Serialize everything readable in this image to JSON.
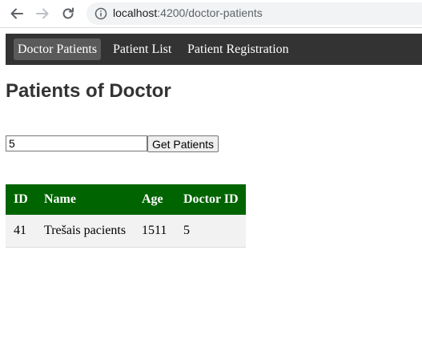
{
  "browser": {
    "url_host": "localhost",
    "url_path": ":4200/doctor-patients"
  },
  "nav": {
    "items": [
      {
        "label": "Doctor Patients",
        "active": true
      },
      {
        "label": "Patient List",
        "active": false
      },
      {
        "label": "Patient Registration",
        "active": false
      }
    ]
  },
  "page": {
    "title": "Patients of Doctor",
    "doctor_id_value": "5",
    "get_button_label": "Get Patients"
  },
  "table": {
    "headers": [
      "ID",
      "Name",
      "Age",
      "Doctor ID"
    ],
    "rows": [
      [
        "41",
        "Trešais pacients",
        "1511",
        "5"
      ]
    ]
  },
  "colors": {
    "navbar_bg": "#333333",
    "table_header_bg": "#006400",
    "row_bg": "#f2f2f2"
  }
}
